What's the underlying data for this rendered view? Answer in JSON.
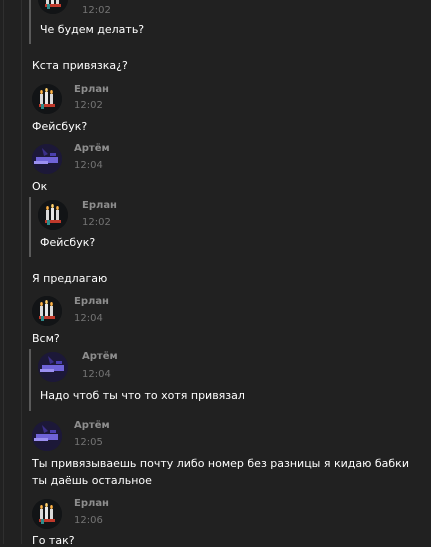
{
  "messages": [
    {
      "time": "12:02",
      "text": "Че будем делать?"
    },
    {
      "text": "Кста привязка¿?"
    },
    {
      "name": "Ерлан",
      "time": "12:02",
      "text": "Фейсбук?"
    },
    {
      "name": "Артём",
      "time": "12:04",
      "text": "Ок"
    },
    {
      "name": "Ерлан",
      "time": "12:02",
      "text": "Фейсбук?"
    },
    {
      "text": "Я предлагаю"
    },
    {
      "name": "Ерлан",
      "time": "12:04",
      "text": "Всм?"
    },
    {
      "name": "Артём",
      "time": "12:04",
      "text": "Надо чтоб ты что то хотя привязал"
    },
    {
      "name": "Артём",
      "time": "12:05",
      "text": "Ты привязываешь почту либо номер без разницы я кидаю бабки ты даёшь остальное"
    },
    {
      "name": "Ерлан",
      "time": "12:06",
      "text": "Го так?"
    }
  ],
  "avatars": {
    "erlan": "candles-avatar-icon",
    "artem": "purple-glitch-avatar-icon"
  },
  "colors": {
    "background": "#212121",
    "name": "#8e8e8e",
    "time": "#747474",
    "text": "#ffffff",
    "quote_bar": "#5a5a5a"
  }
}
